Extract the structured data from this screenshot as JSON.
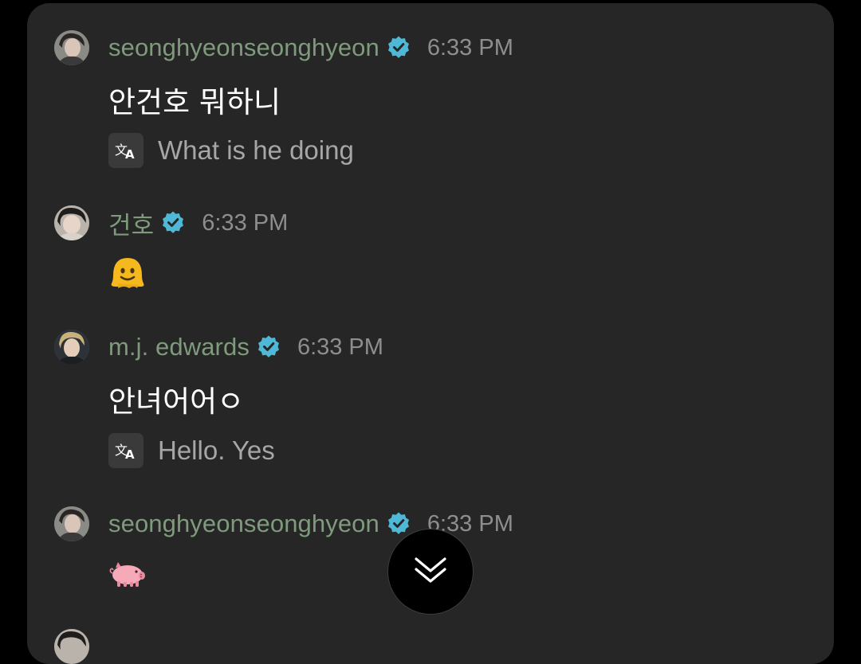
{
  "messages": [
    {
      "username": "seonghyeonseonghyeon",
      "time": "6:33 PM",
      "text": "안건호 뭐하니",
      "translation": "What is he doing"
    },
    {
      "username": "건호",
      "time": "6:33 PM",
      "emoji": "melting-face-emoji"
    },
    {
      "username": "m.j. edwards",
      "time": "6:33 PM",
      "text": "안녀어어ㅇ",
      "translation": "Hello. Yes"
    },
    {
      "username": "seonghyeonseonghyeon",
      "time": "6:33 PM",
      "emoji": "pig-emoji"
    }
  ],
  "icons": {
    "verified": "verified-badge-icon",
    "translate": "translate-icon",
    "scroll_down": "double-chevron-down-icon"
  },
  "colors": {
    "background": "#000000",
    "panel": "#262626",
    "username": "#7f9a7c",
    "verified": "#4fb8d6",
    "timestamp": "#8e8e8e",
    "message_text": "#ffffff",
    "translation_text": "#a6a6a6"
  }
}
